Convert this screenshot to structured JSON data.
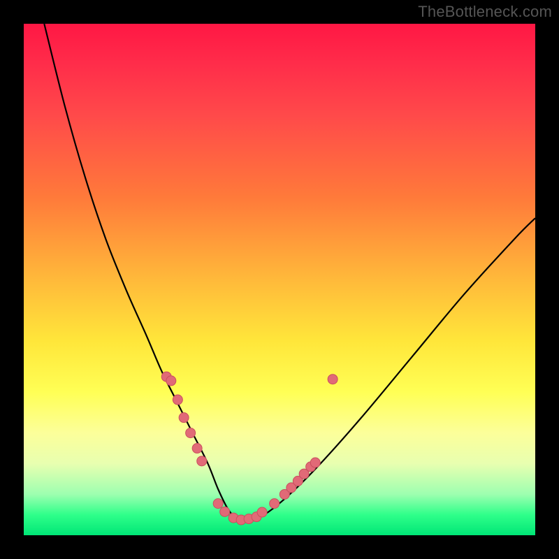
{
  "watermark": "TheBottleneck.com",
  "colors": {
    "frame": "#000000",
    "gradient_top": "#ff1744",
    "gradient_mid": "#ffe63a",
    "gradient_bottom": "#00e676",
    "curve": "#000000",
    "dot_fill": "#e16a77",
    "dot_stroke": "#c94f5e"
  },
  "chart_data": {
    "type": "line",
    "title": "",
    "xlabel": "",
    "ylabel": "",
    "xlim": [
      0,
      100
    ],
    "ylim": [
      0,
      100
    ],
    "grid": false,
    "annotations": [
      "TheBottleneck.com"
    ],
    "series": [
      {
        "name": "bottleneck-curve",
        "x": [
          4,
          8,
          12,
          16,
          20,
          24,
          27,
          30,
          33,
          36,
          38,
          40,
          42,
          44,
          47,
          52,
          58,
          66,
          76,
          86,
          96,
          100
        ],
        "y": [
          100,
          84,
          70,
          58,
          48,
          39,
          32,
          26,
          20,
          14,
          9,
          5,
          3,
          3,
          4,
          8,
          14,
          23,
          35,
          47,
          58,
          62
        ]
      }
    ],
    "markers": [
      {
        "name": "dots-left-branch",
        "x": [
          27.9,
          28.8,
          30.1,
          31.3,
          32.6,
          33.9,
          34.8
        ],
        "y": [
          31.0,
          30.2,
          26.5,
          23.0,
          20.0,
          17.0,
          14.5
        ]
      },
      {
        "name": "dots-trough",
        "x": [
          38.0,
          39.3,
          41.0,
          42.5,
          44.0,
          45.5,
          46.6
        ],
        "y": [
          6.2,
          4.6,
          3.4,
          3.0,
          3.2,
          3.6,
          4.5
        ]
      },
      {
        "name": "dots-right-branch",
        "x": [
          49.0,
          51.0,
          52.3,
          53.6,
          54.8,
          56.1,
          57.0,
          60.4
        ],
        "y": [
          6.2,
          8.0,
          9.3,
          10.6,
          12.0,
          13.4,
          14.2,
          30.5
        ]
      }
    ]
  }
}
